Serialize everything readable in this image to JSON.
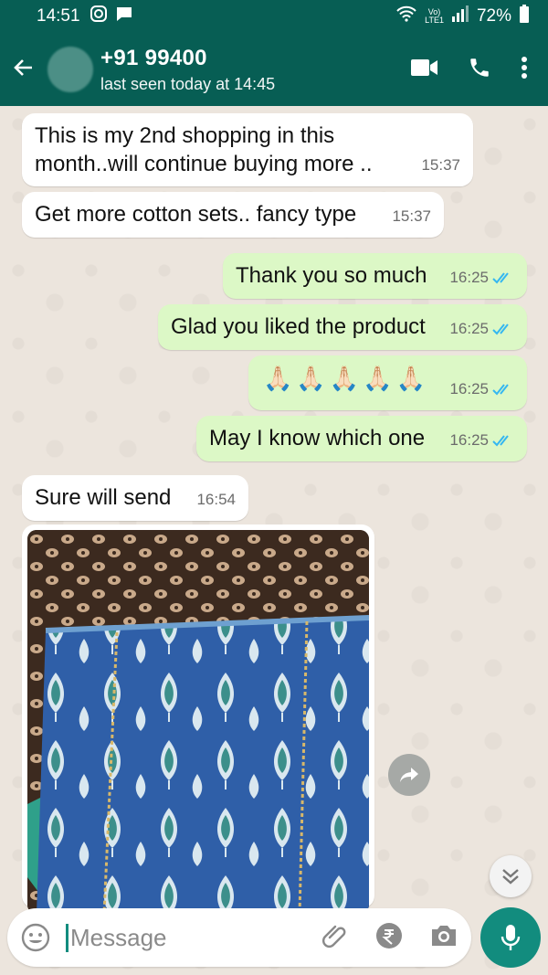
{
  "status_bar": {
    "time": "14:51",
    "network_top": "Vo)",
    "network_bottom": "LTE1",
    "battery": "72%"
  },
  "header": {
    "contact_name": "+91 99400",
    "last_seen": "last seen today at 14:45"
  },
  "messages": [
    {
      "direction": "in",
      "text": "This is my 2nd shopping in this month..will continue buying more ..",
      "time": "15:37"
    },
    {
      "direction": "in",
      "text": "Get more cotton sets.. fancy type",
      "time": "15:37"
    },
    {
      "direction": "out",
      "text": "Thank you so much",
      "time": "16:25"
    },
    {
      "direction": "out",
      "text": "Glad you liked the product",
      "time": "16:25"
    },
    {
      "direction": "out",
      "text": "🙏🏻🙏🏻🙏🏻🙏🏻🙏🏻",
      "time": "16:25"
    },
    {
      "direction": "out",
      "text": "May I know which one",
      "time": "16:25"
    },
    {
      "direction": "in",
      "text": "Sure will send",
      "time": "16:54"
    }
  ],
  "composer": {
    "placeholder": "Message"
  },
  "colors": {
    "header": "#075e54",
    "outgoing_bubble": "#dcf8c6",
    "accent": "#128c7e",
    "read_ticks": "#34b7f1"
  }
}
